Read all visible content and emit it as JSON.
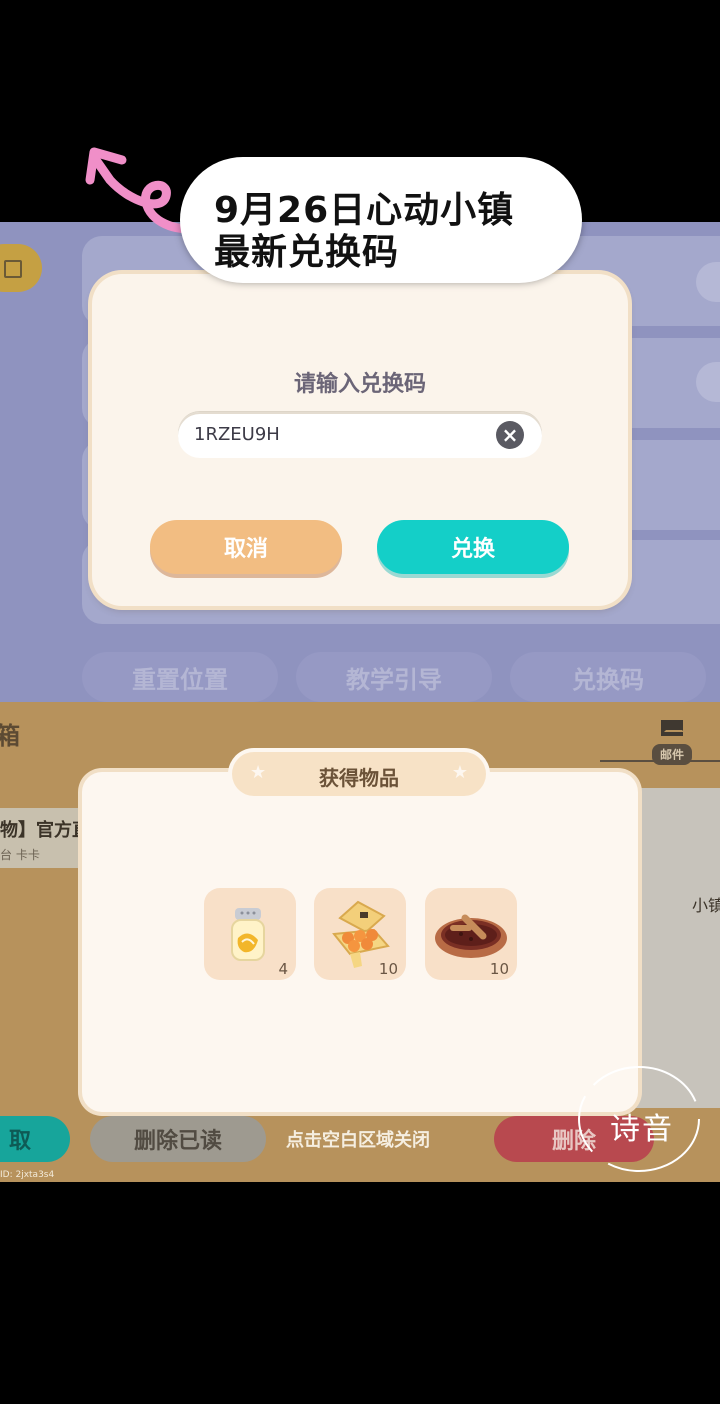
{
  "overlay_title": {
    "line1": "9月26日心动小镇",
    "line2": "最新兑换码"
  },
  "settings_background": {
    "buttons": [
      "重置位置",
      "教学引导",
      "兑换码"
    ]
  },
  "redeem_dialog": {
    "title": "请输入兑换码",
    "code_value": "1RZEU9H",
    "clear_glyph": "×",
    "cancel_label": "取消",
    "redeem_label": "兑换"
  },
  "mailbox_background": {
    "title": "箱",
    "tab_label": "邮件",
    "item_title": "物】官方直",
    "item_subtitle": "台 卡卡",
    "right_text": "小镇",
    "claim_button": "取",
    "delete_read_button": "删除已读",
    "delete_button": "删除",
    "uid_text": "ID: 2jxta3s4",
    "close_hint": "点击空白区域关闭"
  },
  "items_dialog": {
    "title": "获得物品",
    "items": [
      {
        "icon": "spice-jar-icon",
        "quantity": "4"
      },
      {
        "icon": "egg-carton-icon",
        "quantity": "10"
      },
      {
        "icon": "chocolate-pie-icon",
        "quantity": "10"
      }
    ]
  },
  "watermark": {
    "text": "诗音"
  },
  "colors": {
    "cancel": "#f2bd82",
    "redeem": "#14cfc8",
    "settings_bg": "#8f93bf",
    "mailbox_bg": "#b7925c",
    "dialog_bg": "#fbf4eb",
    "arrow": "#f08fc8"
  }
}
